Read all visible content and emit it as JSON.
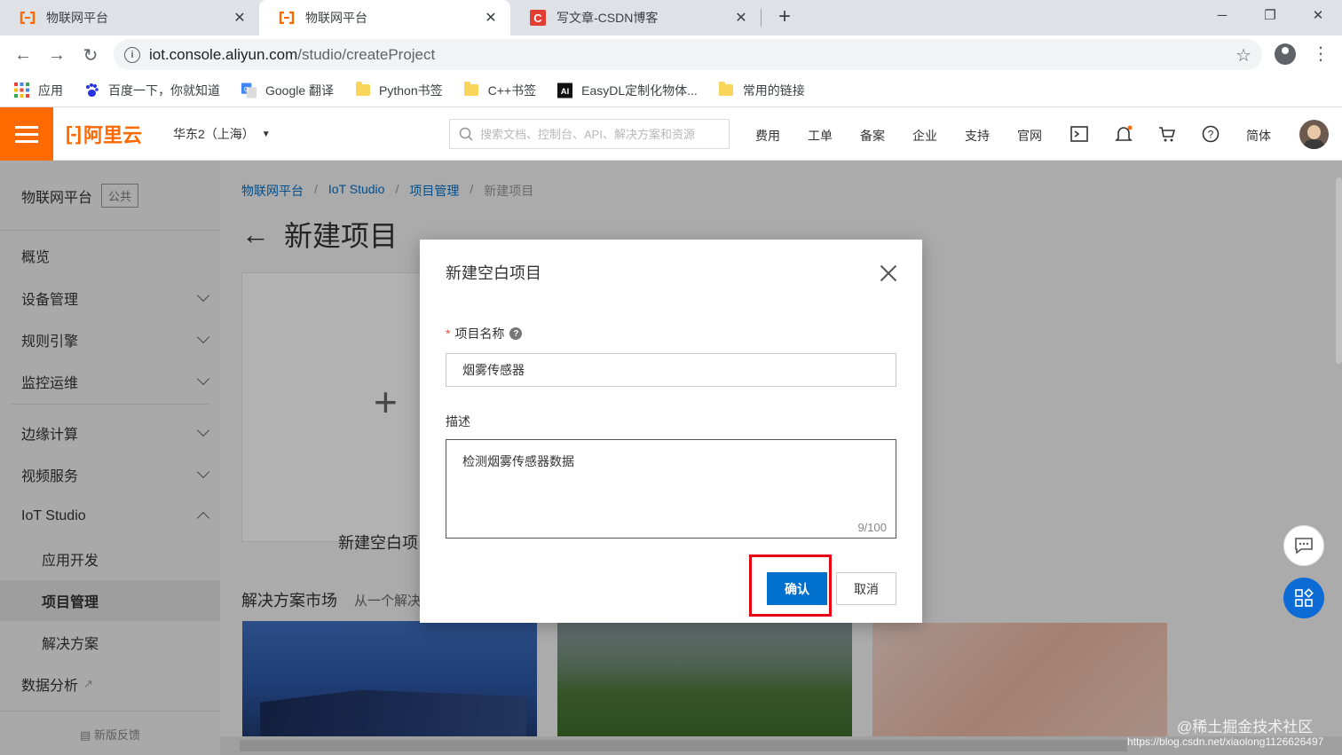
{
  "browser": {
    "tabs": [
      {
        "title": "物联网平台",
        "active": false
      },
      {
        "title": "物联网平台",
        "active": true
      },
      {
        "title": "写文章-CSDN博客",
        "active": false
      }
    ],
    "new_tab": "+",
    "url_host": "iot.console.aliyun.com",
    "url_path": "/studio/createProject",
    "bookmarks": [
      {
        "label": "应用",
        "icon": "apps-grid-icon"
      },
      {
        "label": "百度一下，你就知道",
        "icon": "baidu-paw-icon"
      },
      {
        "label": "Google 翻译",
        "icon": "google-translate-icon"
      },
      {
        "label": "Python书签",
        "icon": "folder-icon"
      },
      {
        "label": "C++书签",
        "icon": "folder-icon"
      },
      {
        "label": "EasyDL定制化物体...",
        "icon": "ai-logo-icon"
      },
      {
        "label": "常用的链接",
        "icon": "folder-icon"
      }
    ]
  },
  "header": {
    "brand": "阿里云",
    "region": "华东2（上海）",
    "search_placeholder": "搜索文档、控制台、API、解决方案和资源",
    "nav": [
      "费用",
      "工单",
      "备案",
      "企业",
      "支持",
      "官网"
    ],
    "lang": "简体"
  },
  "sidebar": {
    "title": "物联网平台",
    "badge": "公共",
    "items": [
      {
        "label": "概览"
      },
      {
        "label": "设备管理"
      },
      {
        "label": "规则引擎"
      },
      {
        "label": "监控运维"
      },
      {
        "label": "边缘计算"
      },
      {
        "label": "视频服务"
      },
      {
        "label": "IoT Studio"
      },
      {
        "label": "应用开发"
      },
      {
        "label": "项目管理"
      },
      {
        "label": "解决方案"
      },
      {
        "label": "数据分析"
      }
    ],
    "feedback": "新版反馈"
  },
  "main": {
    "breadcrumb": [
      "物联网平台",
      "IoT Studio",
      "项目管理",
      "新建项目"
    ],
    "page_title": "新建项目",
    "blank_card_label": "新建空白项",
    "market_title": "解决方案市场",
    "market_sub": "从一个解决"
  },
  "modal": {
    "title": "新建空白项目",
    "name_label": "项目名称",
    "name_value": "烟雾传感器",
    "desc_label": "描述",
    "desc_value": "检测烟雾传感器数据",
    "counter": "9/100",
    "ok_label": "确认",
    "cancel_label": "取消"
  },
  "watermark": {
    "line1": "@稀土掘金技术社区",
    "line2": "https://blog.csdn.net/xiaolong1126626497"
  },
  "colors": {
    "brand_orange": "#ff6a00",
    "primary_blue": "#0070cc",
    "highlight_red": "#e60012"
  }
}
